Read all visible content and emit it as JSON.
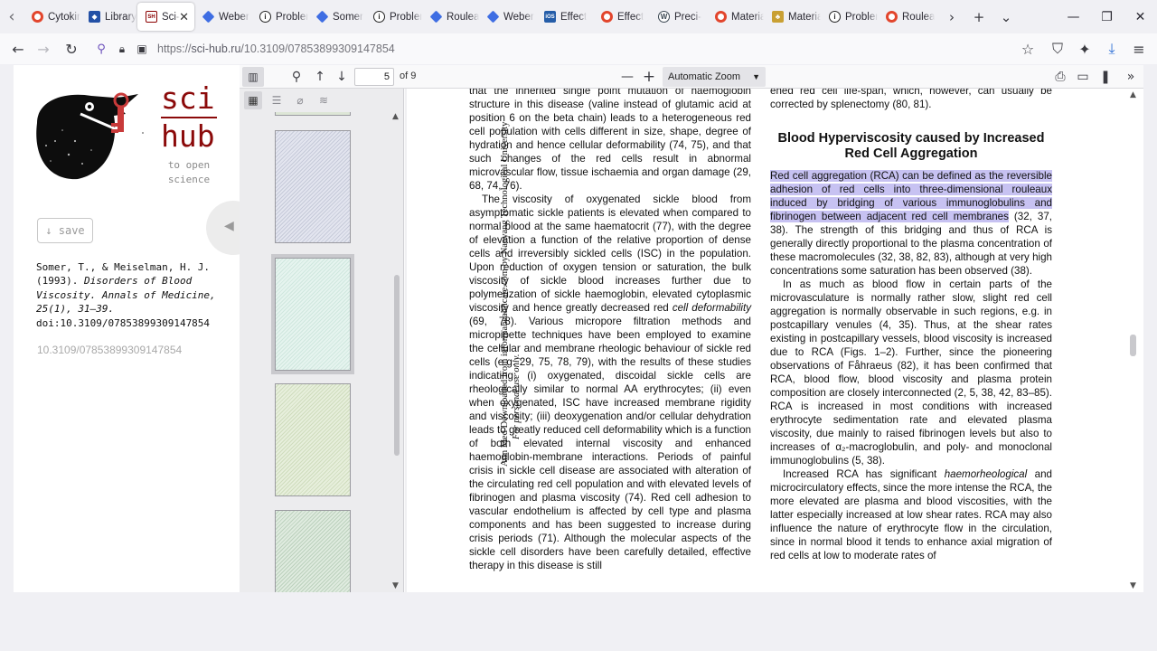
{
  "browser": {
    "tabs": [
      {
        "title": "Cytokines",
        "favicon": "opera"
      },
      {
        "title": "Library",
        "favicon": "lib"
      },
      {
        "title": "Sci-Hub",
        "favicon": "scihub",
        "active": true
      },
      {
        "title": "Weber",
        "favicon": "diamond"
      },
      {
        "title": "Problem",
        "favicon": "info"
      },
      {
        "title": "Somer",
        "favicon": "diamond"
      },
      {
        "title": "Problem",
        "favicon": "info"
      },
      {
        "title": "Rouleaux",
        "favicon": "diamond"
      },
      {
        "title": "Weber",
        "favicon": "diamond"
      },
      {
        "title": "Effect",
        "favicon": "ios"
      },
      {
        "title": "Effect",
        "favicon": "opera"
      },
      {
        "title": "Preci-",
        "favicon": "wp"
      },
      {
        "title": "Material",
        "favicon": "opera"
      },
      {
        "title": "Material",
        "favicon": "mat"
      },
      {
        "title": "Problem",
        "favicon": "info"
      },
      {
        "title": "Rouleaux",
        "favicon": "opera"
      }
    ],
    "url_prefix": "https://",
    "url_host": "sci-hub.ru",
    "url_path": "/10.3109/07853899309147854",
    "icons": {
      "back": "back-arrow-icon",
      "forward": "forward-arrow-icon",
      "reload": "reload-icon",
      "bookmark": "star-icon",
      "shield": "shield-icon",
      "extensions": "extensions-icon",
      "downloads": "download-icon",
      "menu": "hamburger-icon"
    }
  },
  "scihub": {
    "logo_top": "sci",
    "logo_bottom": "hub",
    "tagline": "to open science",
    "save_label": "↓ save",
    "citation_authors": "Somer, T., & Meiselman, H. J. (1993).",
    "citation_title": "Disorders of Blood Viscosity. Annals of Medicine, 25(1), 31–39.",
    "citation_doi": "doi:10.3109/07853899309147854",
    "doi_link": "10.3109/07853899309147854",
    "accent_color": "#8b0a0a"
  },
  "pdf_viewer": {
    "current_page": "5",
    "page_count_label": "of 9",
    "zoom_label": "Automatic Zoom",
    "download_note_1": "Ann Med Downloaded from informahealthcare.com by Nanyang Technological University",
    "download_note_2": "For personal use only.",
    "left_column": {
      "p1": "that the inherited single point mutation of haemoglobin structure in this disease (valine instead of glutamic acid at position 6 on the beta chain) leads to a heterogeneous red cell population with cells different in size, shape, degree of hydration and hence cellular deformability (74, 75), and that such changes of the red cells result in abnormal microvascular flow, tissue ischaemia and organ damage (29, 68, 74, 76).",
      "p2_a": "The viscosity of oxygenated sickle blood from asymptomatic sickle patients is elevated when compared to normal blood at the same haematocrit (77), with the degree of elevation a function of the relative proportion of dense cells and irreversibly sickled cells (ISC) in the population. Upon reduction of oxygen tension or saturation, the bulk viscosity of sickle blood increases further due to polymerization of sickle haemoglobin, elevated cytoplasmic viscosity and hence greatly decreased red ",
      "p2_italic": "cell deformability",
      "p2_b": " (69, 78). Various micropore filtration methods and micropipette techniques have been employed to examine the cellular and membrane rheologic behaviour of sickle red cells (e.g. 29, 75, 78, 79), with the results of these studies indicating: (i) oxygenated, discoidal sickle cells are rheologically similar to normal AA erythrocytes; (ii) even when oxygenated, ISC have increased membrane rigidity and viscosity; (iii) deoxygenation and/or cellular dehydration leads to greatly reduced cell deformability which is a function of both elevated internal viscosity and enhanced haemoglobin-membrane interactions. Periods of painful crisis in sickle cell disease are associated with alteration of the circulating red cell population and with elevated levels of fibrinogen and plasma viscosity (74). Red cell adhesion to vascular endothelium is affected by cell type and plasma components and has been suggested to increase during crisis periods (71). Although the molecular aspects of the sickle cell disorders have been carefully detailed, effective therapy in this disease is still"
    },
    "right_column": {
      "p0": "ened red cell life-span, which, however, can usually be corrected by splenectomy (80, 81).",
      "heading": "Blood Hyperviscosity caused by Increased Red Cell Aggregation",
      "p1_highlight": "Red cell aggregation (RCA) can be defined as the reversible adhesion of red cells into three-dimensional rouleaux induced by bridging of various immunoglobulins and fibrinogen between adjacent red cell membranes",
      "p1_rest": " (32, 37, 38). The strength of this bridging and thus of RCA is generally directly proportional to the plasma concentration of these macromolecules (32, 38, 82, 83), although at very high concentrations some saturation has been observed (38).",
      "p2": "In as much as blood flow in certain parts of the microvasculature is normally rather slow, slight red cell aggregation is normally observable in such regions, e.g. in postcapillary venules (4, 35). Thus, at the shear rates existing in postcapillary vessels, blood viscosity is increased due to RCA (Figs. 1–2). Further, since the pioneering observations of Fåhraeus (82), it has been confirmed that RCA, blood flow, blood viscosity and plasma protein composition are closely interconnected (2, 5, 38, 42, 83–85). RCA is increased in most conditions with increased erythrocyte sedimentation rate and elevated plasma viscosity, due mainly to raised fibrinogen levels but also to increases of α₂-macroglobulin, and poly- and monoclonal immunoglobulins (5, 38).",
      "p3_a": "Increased RCA has significant ",
      "p3_italic": "haemorheological",
      "p3_b": " and microcirculatory effects, since the more intense the RCA, the more elevated are plasma and blood viscosities, with the latter especially increased at low shear rates. RCA may also influence the nature of erythrocyte flow in the circulation, since in normal blood it tends to enhance axial migration of red cells at low to moderate rates of"
    },
    "highlight_color": "#c7c2f2"
  }
}
